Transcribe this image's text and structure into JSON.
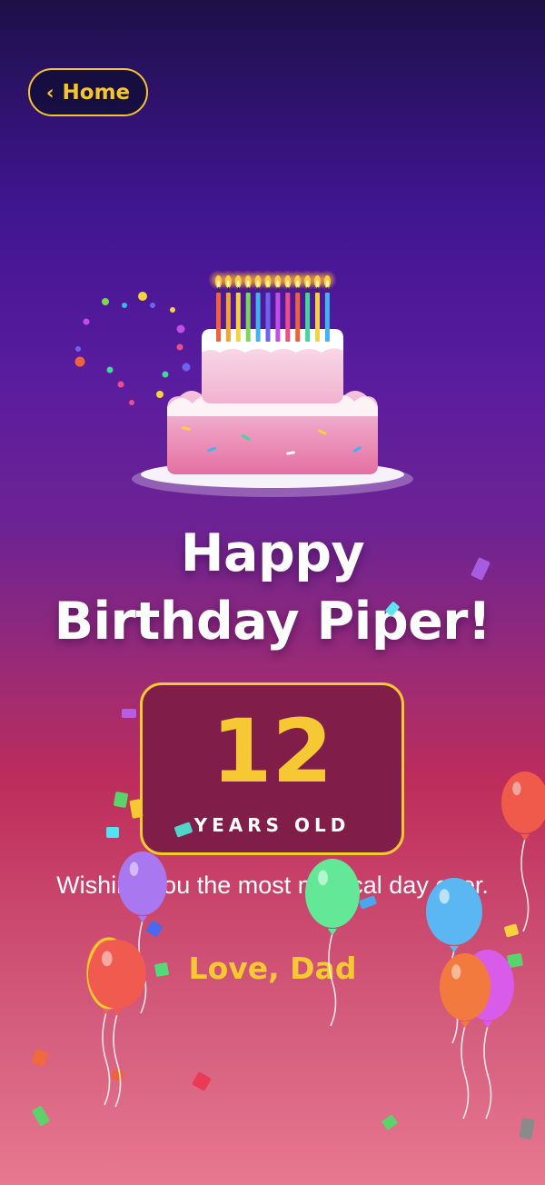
{
  "nav": {
    "back_label": "Home",
    "back_icon": "chevron-left-icon"
  },
  "greeting": {
    "line1": "Happy",
    "line2": "Birthday Piper!"
  },
  "age": {
    "number": "12",
    "label": "YEARS OLD"
  },
  "message": "Wishing you the most magical day ever.",
  "signature": "Love, Dad",
  "colors": {
    "accent": "#f4c531",
    "card_background": "#801d48",
    "text": "#ffffff"
  },
  "decorations": {
    "candle_count": 12,
    "candle_colors": [
      "#f0633a",
      "#f2a531",
      "#f6d33a",
      "#7cd957",
      "#3fb4ee",
      "#6e62f0",
      "#c14ee6",
      "#ef4d8a",
      "#f0633a",
      "#44d69d",
      "#f6d33a",
      "#3fb4ee"
    ],
    "balloon_colors": [
      "#f05a4a",
      "#a978f0",
      "#62e896",
      "#f15a4e",
      "#5bb7f2",
      "#d85bea",
      "#f37a3e",
      "#ee6456"
    ]
  }
}
